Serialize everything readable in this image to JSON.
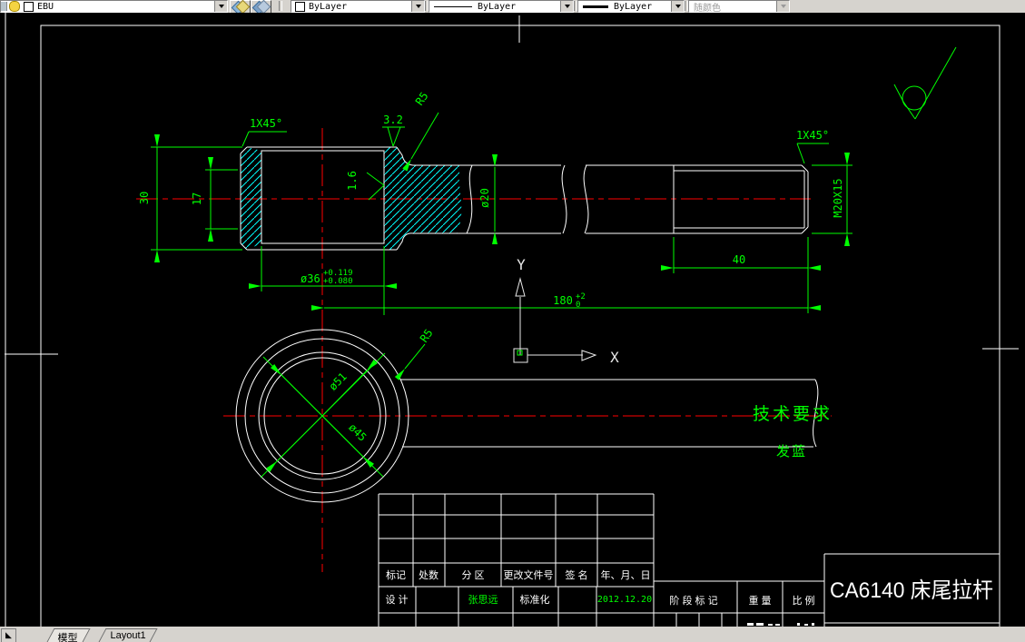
{
  "toolbar": {
    "layer": {
      "name": "EBU"
    },
    "color": {
      "value": "ByLayer"
    },
    "linetype": {
      "value": "ByLayer"
    },
    "lineweight": {
      "value": "ByLayer"
    },
    "plot_style": {
      "value": "随颜色"
    }
  },
  "drawing": {
    "dims": {
      "chamfer_left": "1X45°",
      "roughness_32": "3.2",
      "radius_main": "R5",
      "len_30": "30",
      "len_17": "17",
      "roughness_16": "1.6",
      "dia_20": "ø20",
      "dia_36": {
        "main": "ø36",
        "tol_upper": "+0.119",
        "tol_lower": "+0.080"
      },
      "len_40": "40",
      "len_180": {
        "main": "180",
        "tol_upper": "+2",
        "tol_lower": "0"
      },
      "thread": "M20X15",
      "chamfer_right": "1X45°",
      "dia_51": "ø51",
      "dia_45": "ø45",
      "radius_circle": "R5"
    },
    "ucs": {
      "x_label": "X",
      "y_label": "Y"
    },
    "notes": {
      "title": "技术要求",
      "item": "发蓝"
    }
  },
  "title_block": {
    "headers": {
      "mark": "标记",
      "count": "处数",
      "zone": "分  区",
      "change_file": "更改文件号",
      "signature": "签  名",
      "date": "年、月、日"
    },
    "design_row": {
      "design": "设  计",
      "designer": "张思远",
      "standardization": "标准化",
      "date": "2012.12.20"
    },
    "stage_mark": "阶 段 标 记",
    "weight": "重  量",
    "scale": "比  例",
    "part_title": "CA6140 床尾拉杆"
  },
  "tabs": {
    "model": "模型",
    "layout1": "Layout1"
  },
  "colors": {
    "dimension_green": "#00FF00",
    "centerline_red": "#FF0000",
    "hatch_cyan": "#00FFFF",
    "geometry_white": "#FFFFFF",
    "toolbar_bg": "#D6D3CE"
  }
}
